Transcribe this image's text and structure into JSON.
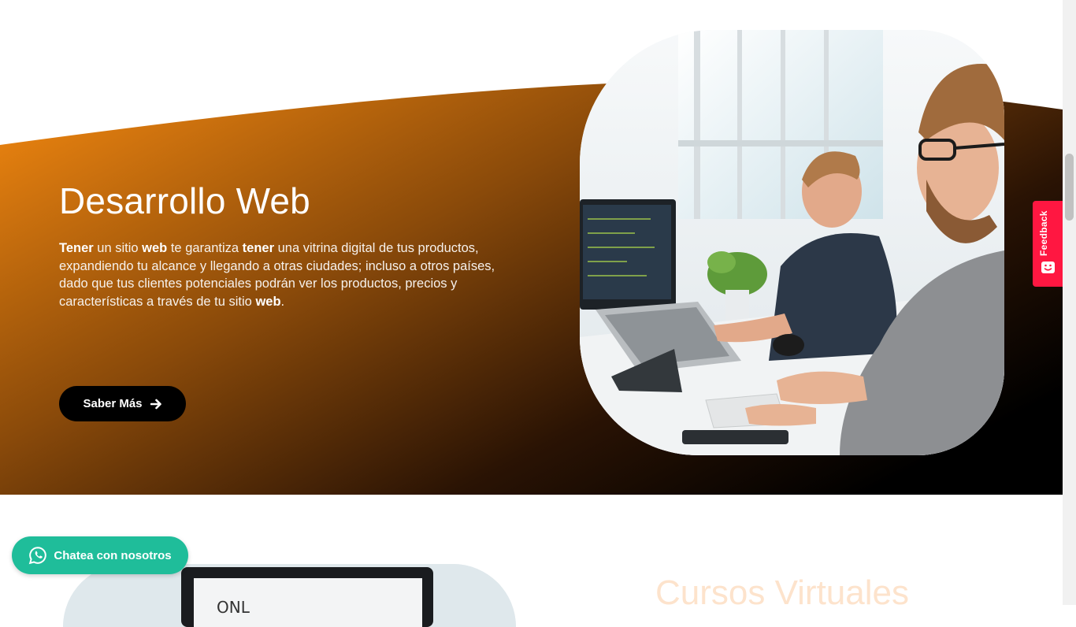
{
  "hero": {
    "title": "Desarrollo Web",
    "description": {
      "t1": "Tener",
      "t2": " un sitio ",
      "t3": "web",
      "t4": " te garantiza ",
      "t5": "tener",
      "t6": " una vitrina digital de tus productos, expandiendo tu alcance y llegando a otras ciudades; incluso a otros países, dado que tus clientes potenciales podrán ver los productos, precios y características a través de tu sitio ",
      "t7": "web",
      "t8": "."
    },
    "cta_label": "Saber Más",
    "cta_icon": "arrow-right-icon",
    "gradient": [
      "#f68a10",
      "#8a4a0a",
      "#000000"
    ]
  },
  "feedback_tab": {
    "label": "Feedback",
    "icon": "smiley-icon",
    "color": "#ff1741"
  },
  "next_section": {
    "title": "Cursos Virtuales"
  },
  "whatsapp": {
    "label": "Chatea con nosotros",
    "icon": "whatsapp-icon",
    "color": "#1fbd9a"
  }
}
